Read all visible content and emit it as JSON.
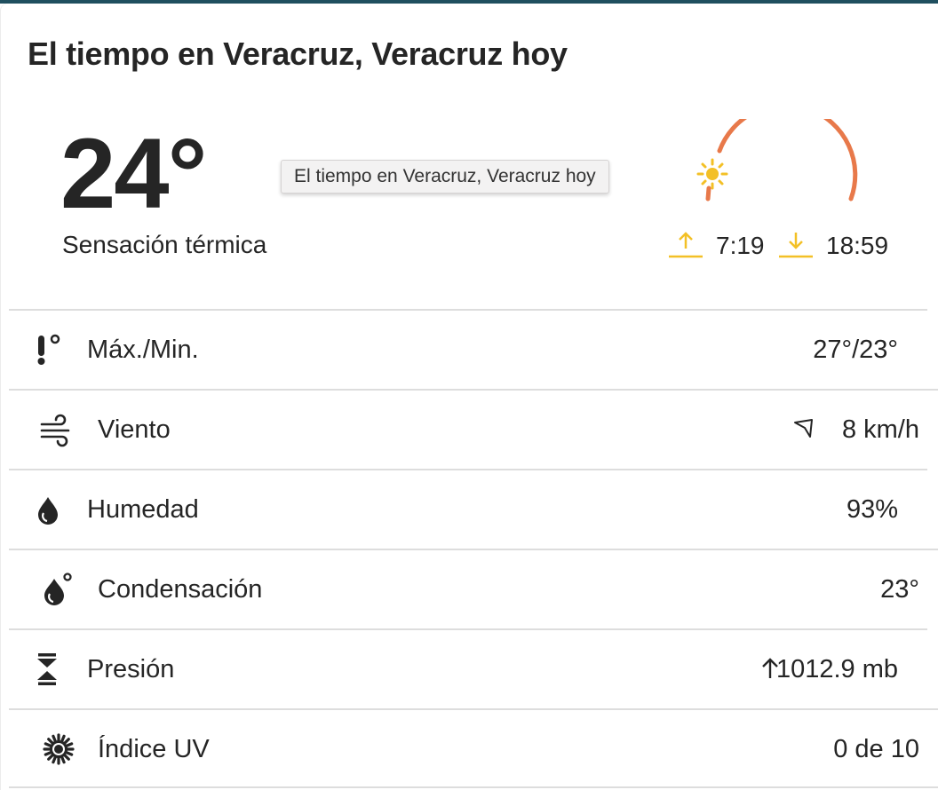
{
  "title": "El tiempo en Veracruz, Veracruz hoy",
  "current": {
    "temperature": "24°",
    "feels_like_label": "Sensación térmica"
  },
  "tooltip": "El tiempo en Veracruz, Veracruz hoy",
  "sun": {
    "sunrise": "7:19",
    "sunset": "18:59",
    "sunrise_icon": "sunrise-arrow-icon",
    "sunset_icon": "sunset-arrow-icon",
    "sun_icon": "sun-icon",
    "arc_color": "#e8794a",
    "sun_color": "#f3c026"
  },
  "details": [
    {
      "icon": "thermometer-icon",
      "label": "Máx./Min.",
      "value": "27°/23°"
    },
    {
      "icon": "wind-icon",
      "label": "Viento",
      "value": "8 km/h",
      "value_icon": "wind-direction-icon"
    },
    {
      "icon": "humidity-drop-icon",
      "label": "Humedad",
      "value": "93%"
    },
    {
      "icon": "dew-point-icon",
      "label": "Condensación",
      "value": "23°"
    },
    {
      "icon": "pressure-icon",
      "label": "Presión",
      "value": "1012.9 mb",
      "value_icon": "arrow-up-icon"
    },
    {
      "icon": "uv-sun-icon",
      "label": "Índice UV",
      "value": "0 de 10"
    }
  ]
}
